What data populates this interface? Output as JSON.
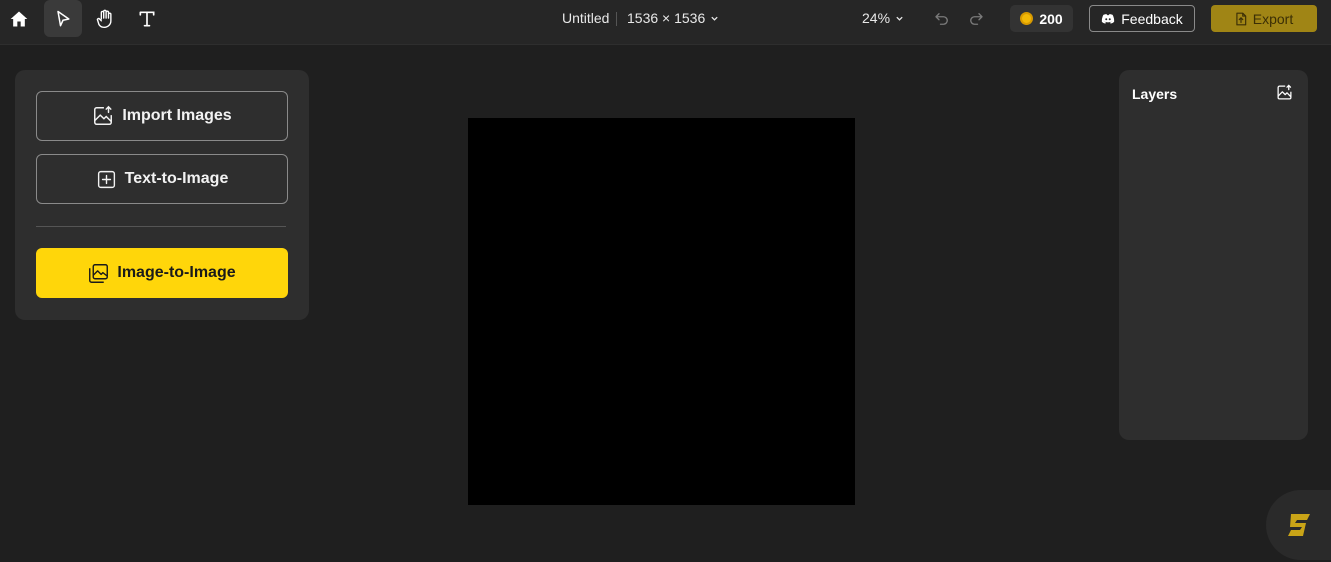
{
  "toolbar": {
    "tools": [
      {
        "name": "home-icon"
      },
      {
        "name": "select-pointer-icon",
        "active": true
      },
      {
        "name": "hand-pan-icon"
      },
      {
        "name": "text-tool-icon"
      }
    ],
    "document_title": "Untitled",
    "canvas_size": "1536 × 1536",
    "zoom": "24%",
    "credits": "200",
    "feedback_label": "Feedback",
    "export_label": "Export"
  },
  "left_panel": {
    "import_label": "Import Images",
    "text_to_image_label": "Text-to-Image",
    "image_to_image_label": "Image-to-Image"
  },
  "layers_panel": {
    "title": "Layers"
  },
  "colors": {
    "accent": "#ffd60a",
    "export_bg": "#a08515",
    "panel_bg": "#2e2e2e",
    "app_bg": "#1f1f1f",
    "coin": "#f2b807"
  }
}
